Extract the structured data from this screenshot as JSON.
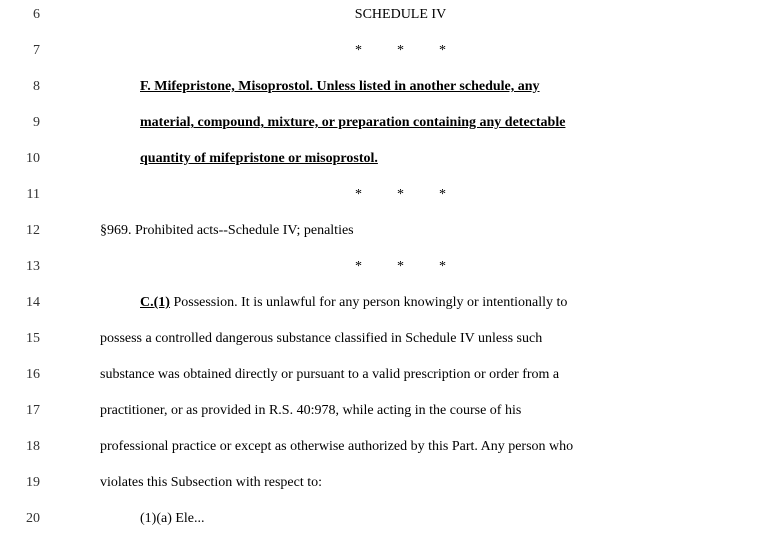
{
  "lines": [
    {
      "number": "6",
      "content": "SCHEDULE IV",
      "style": "centered",
      "bold": false,
      "underline": false
    },
    {
      "number": "7",
      "content": "*          *          *",
      "style": "centered",
      "bold": false,
      "underline": false
    },
    {
      "number": "8",
      "content": "F. Mifepristone, Misoprostol. Unless listed in another schedule, any",
      "style": "indent-1 bold-underline",
      "bold": true,
      "underline": true
    },
    {
      "number": "9",
      "content": "material, compound, mixture, or preparation containing any detectable",
      "style": "bold-underline",
      "bold": true,
      "underline": true
    },
    {
      "number": "10",
      "content": "quantity of mifepristone or misoprostol.",
      "style": "bold-underline",
      "bold": true,
      "underline": true
    },
    {
      "number": "11",
      "content": "*          *          *",
      "style": "centered",
      "bold": false,
      "underline": false
    },
    {
      "number": "12",
      "content": "§969. Prohibited acts--Schedule IV; penalties",
      "style": "indent-2",
      "bold": false,
      "underline": false
    },
    {
      "number": "13",
      "content": "*          *          *",
      "style": "centered",
      "bold": false,
      "underline": false
    },
    {
      "number": "14",
      "content": "C.(1) Possession. It is unlawful for any person knowingly or intentionally to",
      "style": "indent-1",
      "bold": false,
      "underline": false,
      "prefix_bold_underline": "C.",
      "prefix_bold_underline2": "(1)"
    },
    {
      "number": "15",
      "content": "possess a controlled dangerous substance classified in Schedule IV unless such",
      "style": "indent-2",
      "bold": false,
      "underline": false
    },
    {
      "number": "16",
      "content": "substance was obtained directly or pursuant to a valid prescription or order from a",
      "style": "indent-2",
      "bold": false,
      "underline": false
    },
    {
      "number": "17",
      "content": "practitioner, or as provided in R.S. 40:978, while acting in the course of his",
      "style": "indent-2",
      "bold": false,
      "underline": false
    },
    {
      "number": "18",
      "content": "professional practice or except as otherwise authorized by this Part. Any person who",
      "style": "indent-2",
      "bold": false,
      "underline": false
    },
    {
      "number": "19",
      "content": "violates this Subsection with respect to:",
      "style": "indent-2",
      "bold": false,
      "underline": false
    },
    {
      "number": "20",
      "content": "(1)(a) Ele...",
      "style": "indent-1 partial",
      "bold": false,
      "underline": false
    }
  ]
}
